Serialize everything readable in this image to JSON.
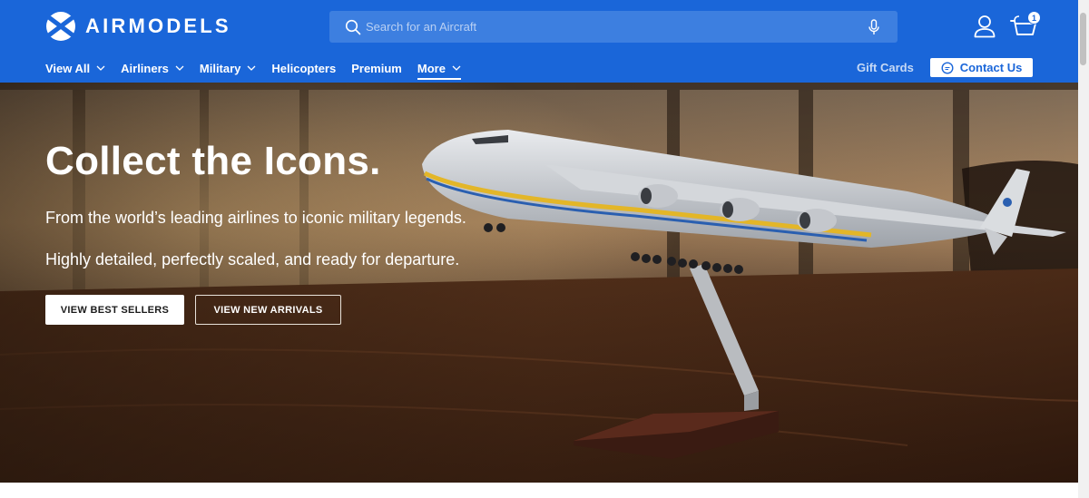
{
  "brand": {
    "name": "AIRMODELS"
  },
  "search": {
    "placeholder": "Search for an Aircraft",
    "value": ""
  },
  "cart": {
    "count": "1"
  },
  "nav": {
    "items": [
      {
        "label": "View All",
        "has_dropdown": true
      },
      {
        "label": "Airliners",
        "has_dropdown": true
      },
      {
        "label": "Military",
        "has_dropdown": true
      },
      {
        "label": "Helicopters",
        "has_dropdown": false
      },
      {
        "label": "Premium",
        "has_dropdown": false
      },
      {
        "label": "More",
        "has_dropdown": true,
        "active": true
      }
    ],
    "gift_cards": "Gift Cards",
    "contact": "Contact Us"
  },
  "hero": {
    "title": "Collect the Icons.",
    "subtitle_1": "From the world’s leading airlines to iconic military legends.",
    "subtitle_2": "Highly detailed, perfectly scaled, and ready for departure.",
    "primary_button": "VIEW BEST SELLERS",
    "secondary_button": "VIEW NEW ARRIVALS"
  },
  "colors": {
    "header": "#1a66d9",
    "search_bg": "#3d7fe0",
    "accent": "#ffffff"
  },
  "icons": [
    "logo-icon",
    "search-icon",
    "mic-icon",
    "user-icon",
    "cart-icon",
    "chevron-down-icon",
    "chat-icon"
  ]
}
